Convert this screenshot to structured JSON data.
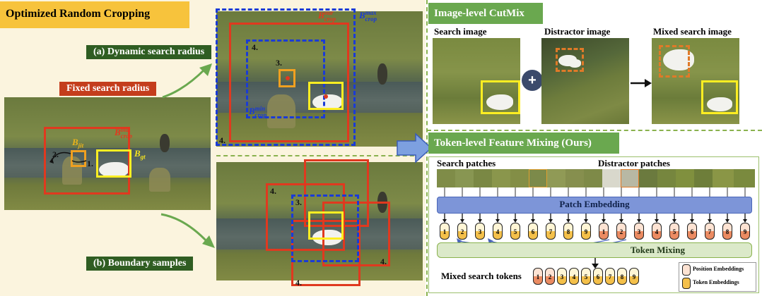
{
  "left": {
    "title": "Optimized Random Cropping",
    "fixed_radius_label": "Fixed search radius",
    "dynamic_label": "(a) Dynamic search radius",
    "boundary_label": "(b) Boundary samples",
    "b_jit": "B",
    "b_jit_sub": "jit",
    "b_gt": "B",
    "b_gt_sub": "gt",
    "b_crop_old": "B",
    "b_crop_old_sup": "old",
    "b_crop_old_sub": "crop",
    "b_crop_our": "B",
    "b_crop_our_sup": "our",
    "b_crop_our_sub": "crop",
    "b_crop_max": "B",
    "b_crop_max_sup": "max",
    "b_crop_max_sub": "crop",
    "b_crop_min": "B",
    "b_crop_min_sup": "min",
    "b_crop_min_sub": "crop",
    "step1": "1.",
    "step2": "2.",
    "step3": "3.",
    "step4": "4."
  },
  "right": {
    "cutmix_title": "Image-level CutMix",
    "search_image": "Search image",
    "distractor_image": "Distractor image",
    "mixed_image": "Mixed search image",
    "plus": "+",
    "feature_title": "Token-level Feature Mixing (Ours)",
    "search_patches": "Search patches",
    "distractor_patches": "Distractor patches",
    "patch_embedding": "Patch Embedding",
    "token_mixing": "Token Mixing",
    "mixed_tokens": "Mixed search tokens",
    "legend_position": "Position Embeddings",
    "legend_token": "Token Embeddings",
    "token_numbers": [
      "1",
      "2",
      "3",
      "4",
      "5",
      "6",
      "7",
      "8",
      "9"
    ],
    "mixed_sequence": [
      "1",
      "2",
      "3",
      "4",
      "5",
      "6",
      "7",
      "8",
      "9"
    ]
  },
  "colors": {
    "accent_yellow_bg": "#f7c33c",
    "panel_cream": "#fbf4de",
    "green_label": "#2f5d22",
    "red_label": "#c43d1c",
    "blue_bar": "#7d95d8",
    "token_mix_bar": "#dbe9c9"
  }
}
